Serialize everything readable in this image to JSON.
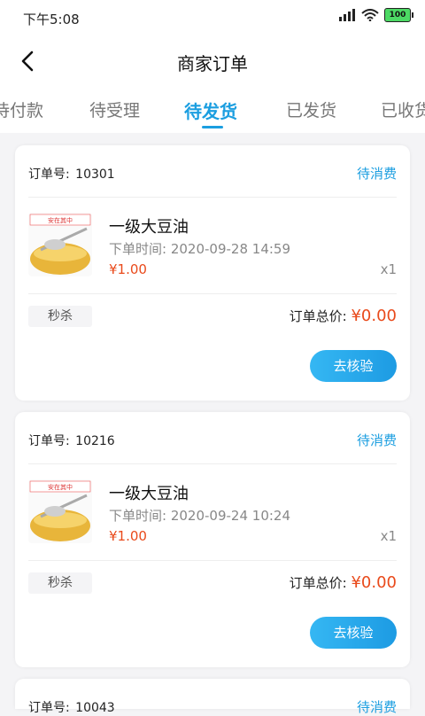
{
  "status_bar": {
    "time": "下午5:08",
    "battery": "100"
  },
  "header": {
    "title": "商家订单"
  },
  "tabs": [
    {
      "label": "待付款"
    },
    {
      "label": "待受理"
    },
    {
      "label": "待发货"
    },
    {
      "label": "已发货"
    },
    {
      "label": "已收货"
    }
  ],
  "labels": {
    "order_no": "订单号:",
    "order_time": "下单时间:",
    "order_total": "订单总价:",
    "verify_button": "去核验"
  },
  "orders": [
    {
      "order_no": "10301",
      "status": "待消费",
      "product_name": "一级大豆油",
      "order_time": "2020-09-28 14:59",
      "price": "¥1.00",
      "qty": "x1",
      "tag": "秒杀",
      "total": "¥0.00",
      "thumb_text": "安在其中"
    },
    {
      "order_no": "10216",
      "status": "待消费",
      "product_name": "一级大豆油",
      "order_time": "2020-09-24 10:24",
      "price": "¥1.00",
      "qty": "x1",
      "tag": "秒杀",
      "total": "¥0.00",
      "thumb_text": "安在其中"
    },
    {
      "order_no": "10043",
      "status": "待消费"
    }
  ],
  "colors": {
    "accent": "#1b9ee0",
    "price": "#e94a1b"
  }
}
